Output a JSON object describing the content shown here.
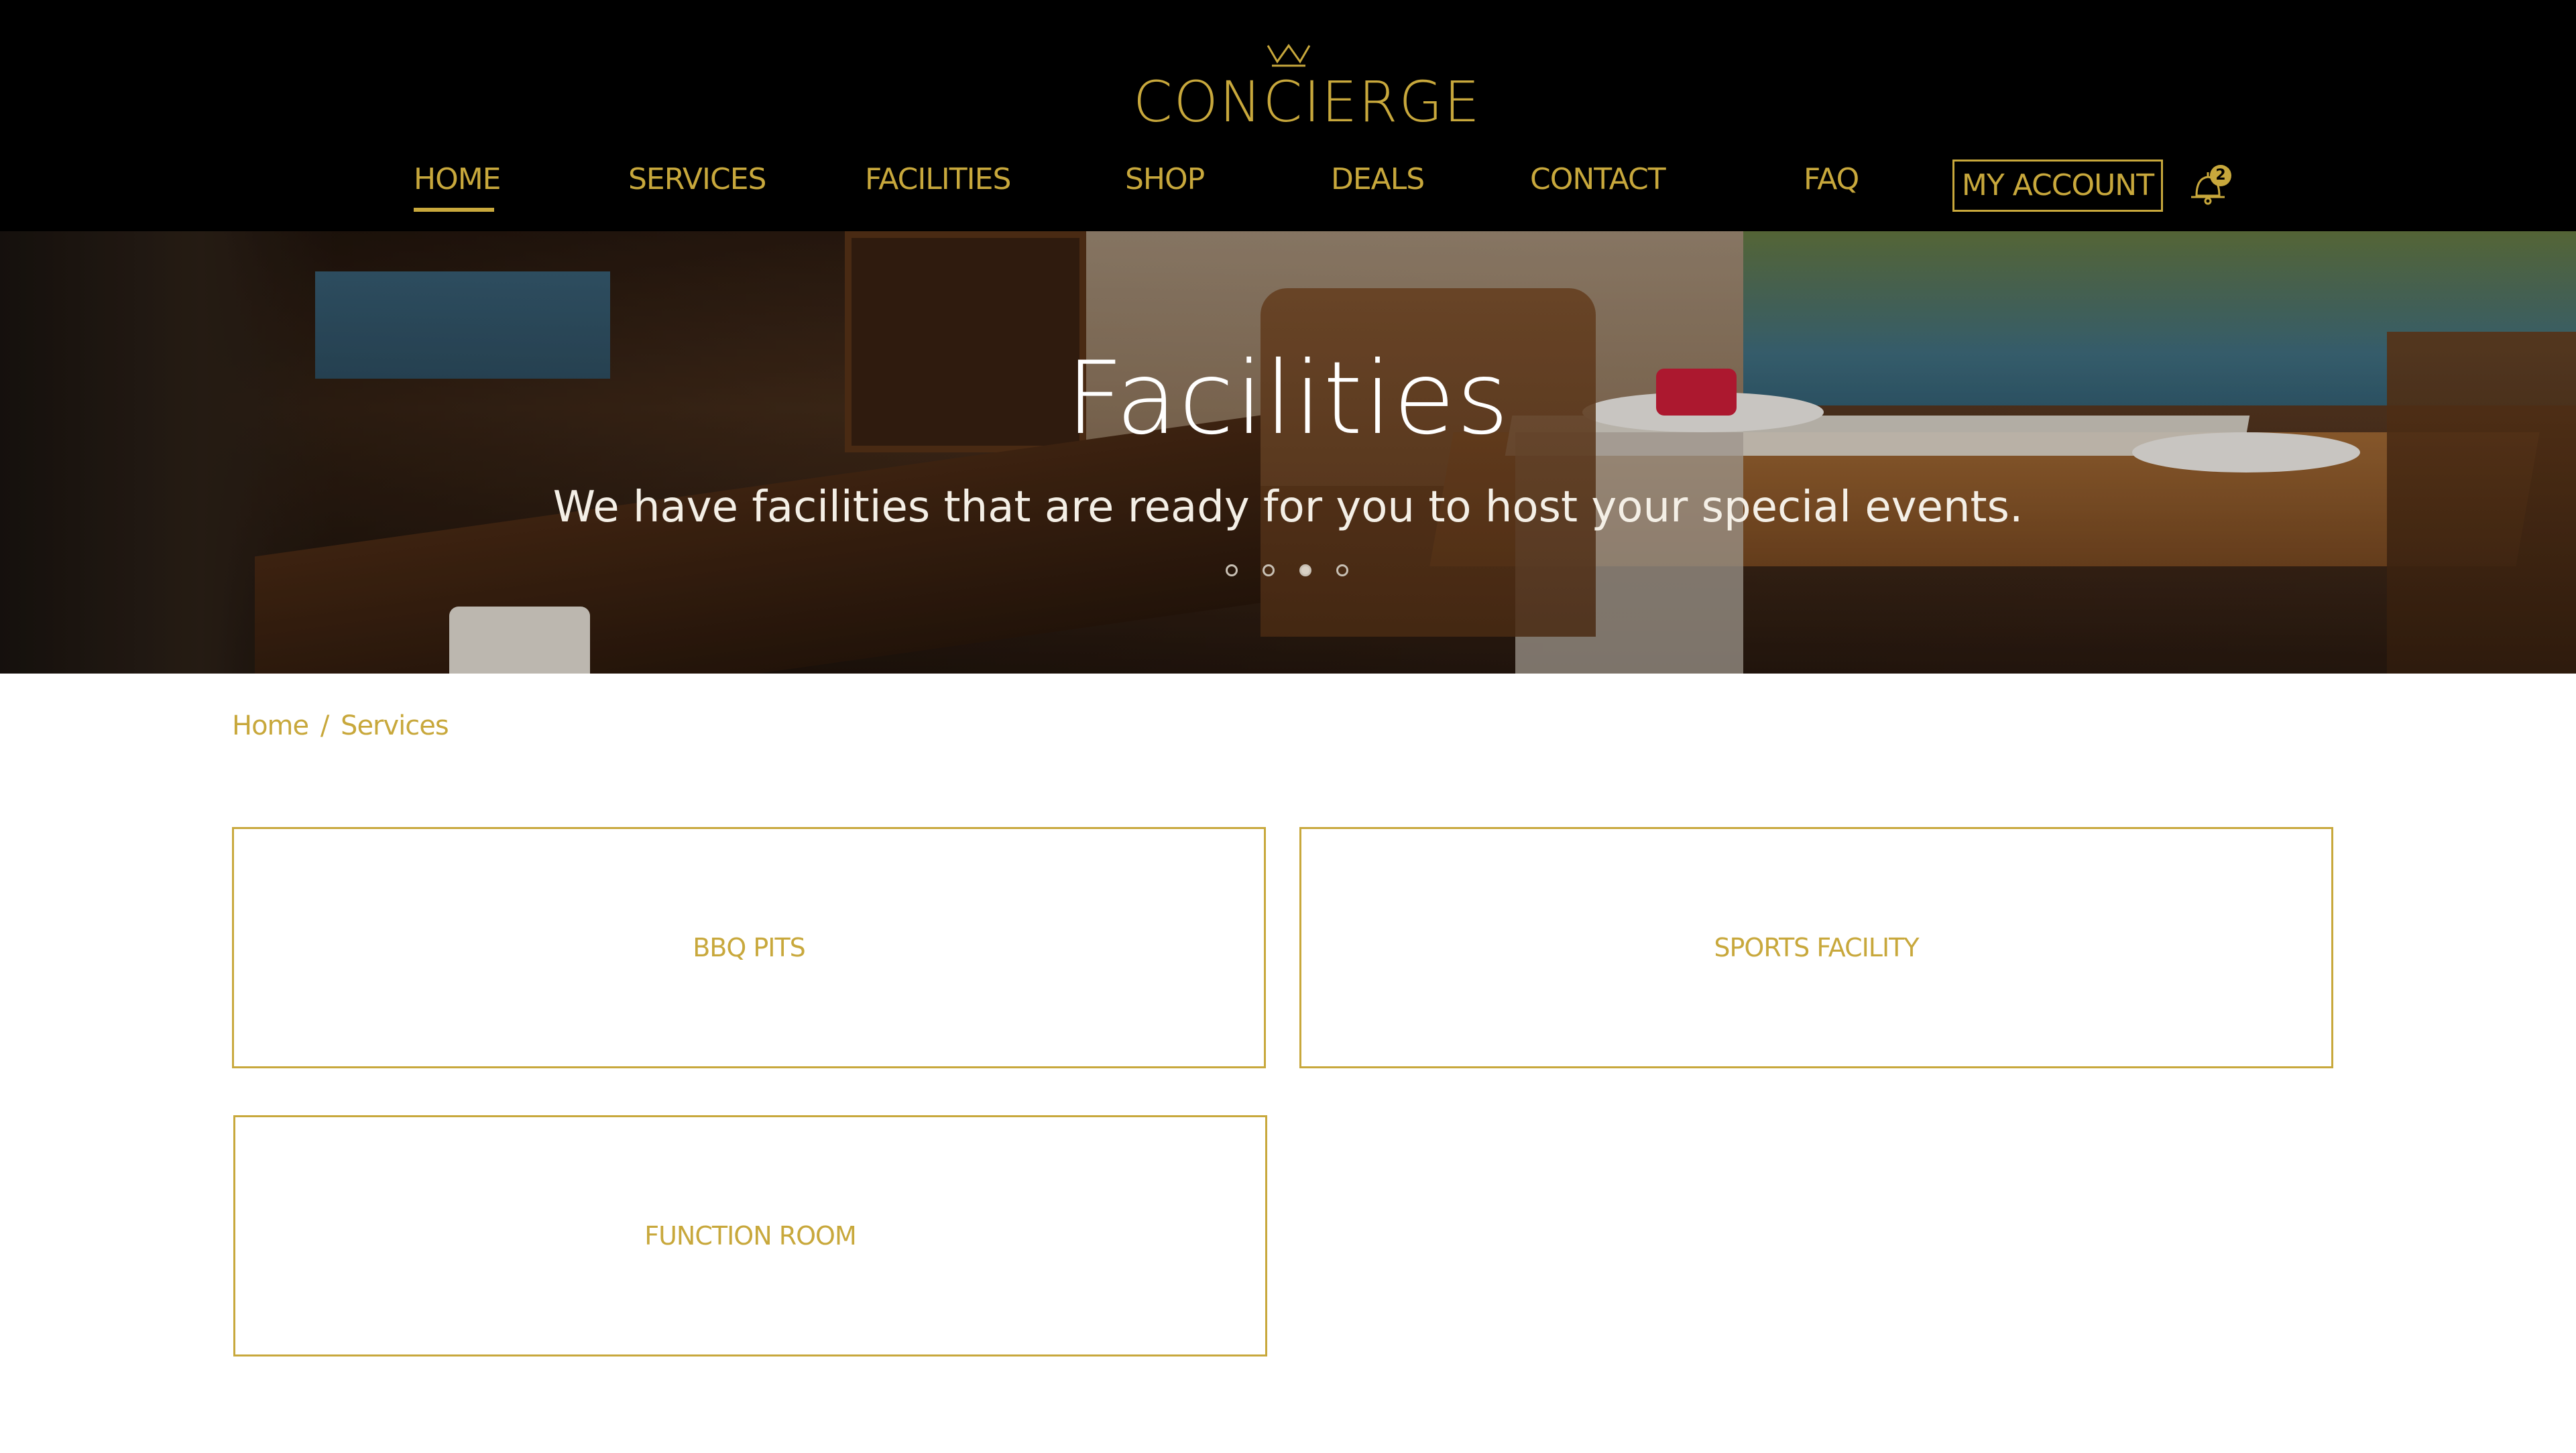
{
  "brand": {
    "name": "CONCIERGE",
    "logo_icon": "crown-icon",
    "accent": "#c8a83c"
  },
  "nav": {
    "items": [
      {
        "label": "HOME",
        "active": true
      },
      {
        "label": "SERVICES"
      },
      {
        "label": "FACILITIES"
      },
      {
        "label": "SHOP"
      },
      {
        "label": "DEALS"
      },
      {
        "label": "CONTACT"
      },
      {
        "label": "FAQ"
      }
    ],
    "account_label": "MY ACCOUNT",
    "notification_count": "2"
  },
  "hero": {
    "title": "Facilities",
    "subtitle": "We have facilities that are ready for you to host your special events.",
    "slides_total": 4,
    "active_slide": 3
  },
  "breadcrumb": {
    "home": "Home",
    "separator": "/",
    "current": "Services"
  },
  "facilities": [
    {
      "label": "BBQ PITS"
    },
    {
      "label": "SPORTS FACILITY"
    },
    {
      "label": "FUNCTION ROOM"
    }
  ]
}
